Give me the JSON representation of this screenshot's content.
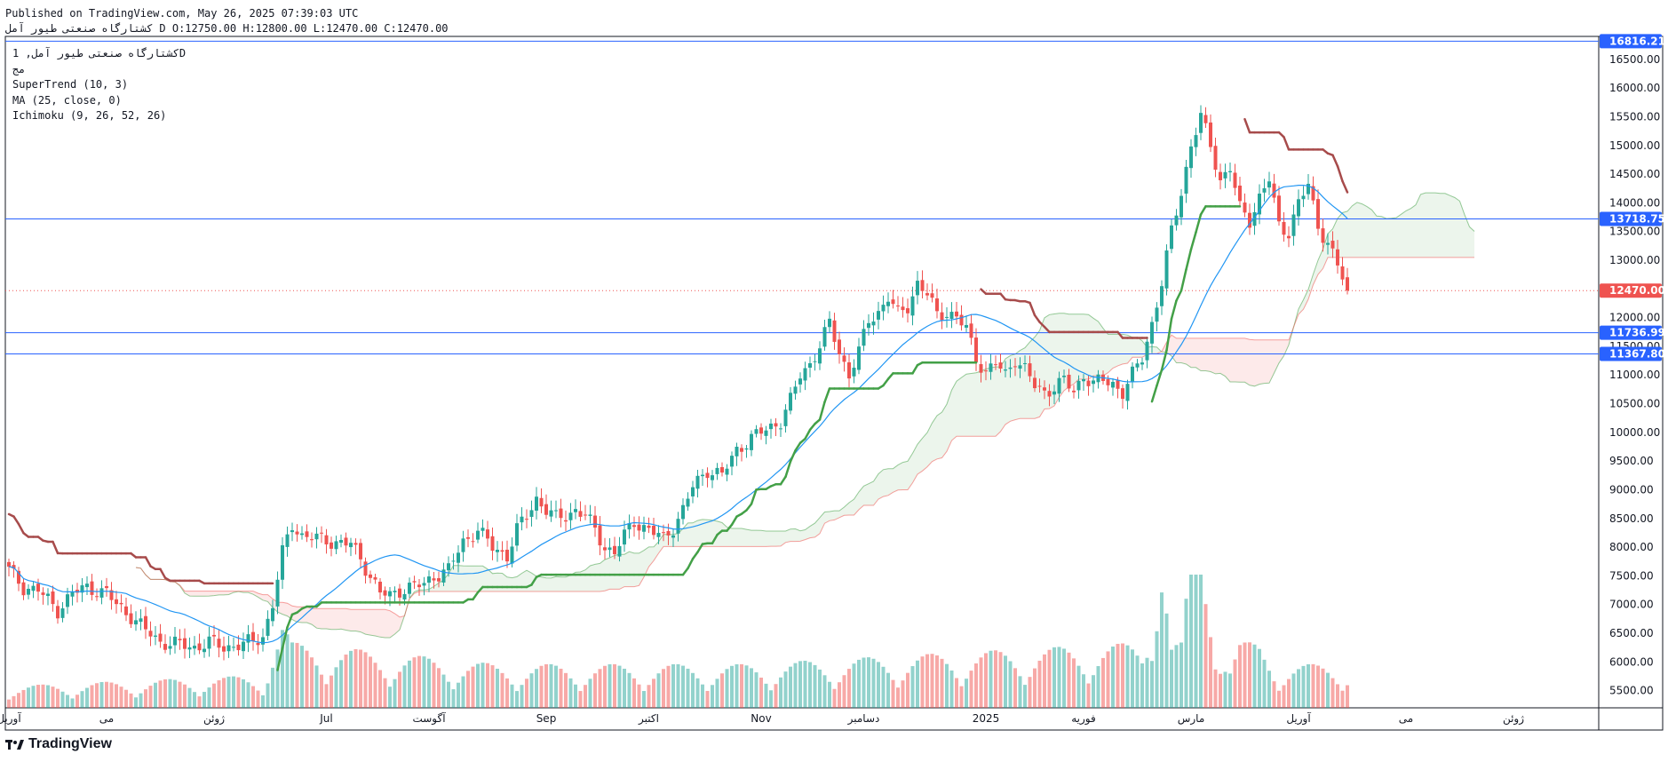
{
  "header": {
    "published_line": "Published on TradingView.com, May 26, 2025 07:39:03 UTC",
    "symbol_line_name": "کشتارگاه صنعتی طیور آمل",
    "symbol_line_ohlc": "O:12750.00 H:12800.00 L:12470.00 C:12470.00"
  },
  "legend": {
    "symbol": "کشتارگاه صنعتی طیور آمل, 1D",
    "sub": "مج",
    "indicators": [
      "SuperTrend (10, 3)",
      "MA (25, close, 0)",
      "Ichimoku (9, 26, 52, 26)"
    ]
  },
  "brand": {
    "label": "TradingView",
    "logo_icon": "tradingview-logo-icon"
  },
  "colors": {
    "up": "#26a69a",
    "down": "#ef5350",
    "supertrend_up": "#43a047",
    "supertrend_down": "#a74b4b",
    "ma": "#2196f3",
    "hline": "#2962ff",
    "price_label": "#ef5350"
  },
  "chart_data": {
    "type": "candlestick",
    "timeframe": "1D",
    "y_axis": {
      "range": [
        5200,
        16900
      ],
      "ticks": [
        "16500.00",
        "16000.00",
        "15500.00",
        "15000.00",
        "14500.00",
        "14000.00",
        "13500.00",
        "13000.00",
        "12500.00",
        "12000.00",
        "11500.00",
        "11000.00",
        "10500.00",
        "10000.00",
        "9500.00",
        "9000.00",
        "8500.00",
        "8000.00",
        "7500.00",
        "7000.00",
        "6500.00",
        "6000.00",
        "5500.00"
      ]
    },
    "x_axis": {
      "labels": [
        "آوریل",
        "می",
        "ژوئن",
        "Jul",
        "آگوست",
        "Sep",
        "اکتبر",
        "Nov",
        "دسامبر",
        "2025",
        "فوریه",
        "مارس",
        "آوریل",
        "می",
        "ژوئن"
      ],
      "label_positions": [
        0,
        20,
        42,
        65,
        86,
        110,
        131,
        154,
        175,
        200,
        220,
        242,
        264,
        286,
        308
      ]
    },
    "price_labels": [
      {
        "value": 16816.21,
        "text": "16816.21",
        "style": "hline"
      },
      {
        "value": 13718.75,
        "text": "13718.75",
        "style": "hline"
      },
      {
        "value": 12470.0,
        "text": "12470.00",
        "style": "last"
      },
      {
        "value": 11736.99,
        "text": "11736.99",
        "style": "hline"
      },
      {
        "value": 11367.8,
        "text": "11367.80",
        "style": "hline"
      }
    ],
    "horizontal_lines": [
      16816.21,
      13718.75,
      11736.99,
      11367.8
    ],
    "last_price": 12470.0,
    "close_key_points": [
      [
        0,
        7600
      ],
      [
        3,
        7300
      ],
      [
        6,
        7250
      ],
      [
        10,
        6900
      ],
      [
        13,
        7200
      ],
      [
        16,
        7300
      ],
      [
        18,
        7250
      ],
      [
        20,
        7200
      ],
      [
        22,
        7000
      ],
      [
        25,
        6800
      ],
      [
        28,
        6550
      ],
      [
        31,
        6350
      ],
      [
        35,
        6300
      ],
      [
        38,
        6250
      ],
      [
        41,
        6350
      ],
      [
        44,
        6250
      ],
      [
        47,
        6300
      ],
      [
        50,
        6350
      ],
      [
        52,
        6450
      ],
      [
        54,
        7000
      ],
      [
        56,
        7900
      ],
      [
        58,
        8400
      ],
      [
        60,
        8200
      ],
      [
        63,
        8150
      ],
      [
        66,
        8100
      ],
      [
        70,
        8050
      ],
      [
        72,
        7800
      ],
      [
        74,
        7500
      ],
      [
        76,
        7200
      ],
      [
        78,
        7150
      ],
      [
        80,
        7250
      ],
      [
        82,
        7300
      ],
      [
        85,
        7350
      ],
      [
        87,
        7500
      ],
      [
        90,
        7600
      ],
      [
        93,
        8100
      ],
      [
        96,
        8300
      ],
      [
        99,
        8000
      ],
      [
        102,
        7850
      ],
      [
        104,
        8300
      ],
      [
        106,
        8550
      ],
      [
        108,
        8850
      ],
      [
        110,
        8650
      ],
      [
        112,
        8500
      ],
      [
        114,
        8550
      ],
      [
        116,
        8650
      ],
      [
        118,
        8550
      ],
      [
        120,
        8300
      ],
      [
        122,
        8000
      ],
      [
        124,
        7900
      ],
      [
        126,
        8200
      ],
      [
        128,
        8450
      ],
      [
        131,
        8300
      ],
      [
        134,
        8150
      ],
      [
        136,
        8350
      ],
      [
        138,
        8650
      ],
      [
        140,
        9050
      ],
      [
        143,
        9350
      ],
      [
        146,
        9250
      ],
      [
        149,
        9700
      ],
      [
        152,
        9900
      ],
      [
        155,
        10050
      ],
      [
        158,
        10200
      ],
      [
        160,
        10550
      ],
      [
        162,
        11000
      ],
      [
        164,
        11200
      ],
      [
        166,
        11500
      ],
      [
        168,
        11900
      ],
      [
        170,
        11400
      ],
      [
        172,
        11000
      ],
      [
        174,
        11400
      ],
      [
        176,
        11950
      ],
      [
        178,
        12100
      ],
      [
        180,
        12350
      ],
      [
        182,
        12050
      ],
      [
        184,
        12200
      ],
      [
        186,
        12600
      ],
      [
        188,
        12400
      ],
      [
        190,
        12050
      ],
      [
        192,
        12100
      ],
      [
        194,
        12000
      ],
      [
        196,
        11800
      ],
      [
        198,
        11300
      ],
      [
        200,
        11050
      ],
      [
        202,
        11200
      ],
      [
        204,
        11000
      ],
      [
        206,
        11300
      ],
      [
        208,
        11100
      ],
      [
        210,
        10800
      ],
      [
        212,
        10700
      ],
      [
        214,
        10800
      ],
      [
        216,
        10900
      ],
      [
        218,
        10700
      ],
      [
        220,
        11000
      ],
      [
        222,
        10850
      ],
      [
        224,
        10900
      ],
      [
        226,
        10850
      ],
      [
        228,
        10700
      ],
      [
        230,
        11000
      ],
      [
        232,
        11300
      ],
      [
        234,
        11900
      ],
      [
        236,
        12600
      ],
      [
        238,
        13500
      ],
      [
        240,
        14200
      ],
      [
        242,
        15000
      ],
      [
        244,
        15500
      ],
      [
        246,
        15000
      ],
      [
        248,
        14400
      ],
      [
        250,
        14600
      ],
      [
        252,
        13900
      ],
      [
        254,
        13700
      ],
      [
        256,
        14100
      ],
      [
        258,
        14400
      ],
      [
        260,
        13600
      ],
      [
        262,
        13500
      ],
      [
        264,
        14000
      ],
      [
        266,
        14300
      ],
      [
        268,
        13600
      ],
      [
        270,
        13300
      ],
      [
        272,
        12900
      ],
      [
        274,
        12470
      ]
    ],
    "volume_key_points": [
      [
        0,
        1
      ],
      [
        52,
        1.5
      ],
      [
        56,
        4
      ],
      [
        58,
        3
      ],
      [
        100,
        2
      ],
      [
        150,
        2
      ],
      [
        232,
        3
      ],
      [
        236,
        8
      ],
      [
        238,
        3
      ],
      [
        240,
        3
      ],
      [
        242,
        7
      ],
      [
        244,
        8
      ],
      [
        246,
        6
      ],
      [
        248,
        3
      ],
      [
        250,
        2
      ],
      [
        252,
        3
      ],
      [
        256,
        3
      ],
      [
        260,
        2
      ],
      [
        274,
        2
      ]
    ],
    "series": [
      {
        "name": "SuperTrend (10, 3)"
      },
      {
        "name": "MA (25, close, 0)",
        "period": 25
      },
      {
        "name": "Ichimoku (9, 26, 52, 26)"
      }
    ]
  }
}
